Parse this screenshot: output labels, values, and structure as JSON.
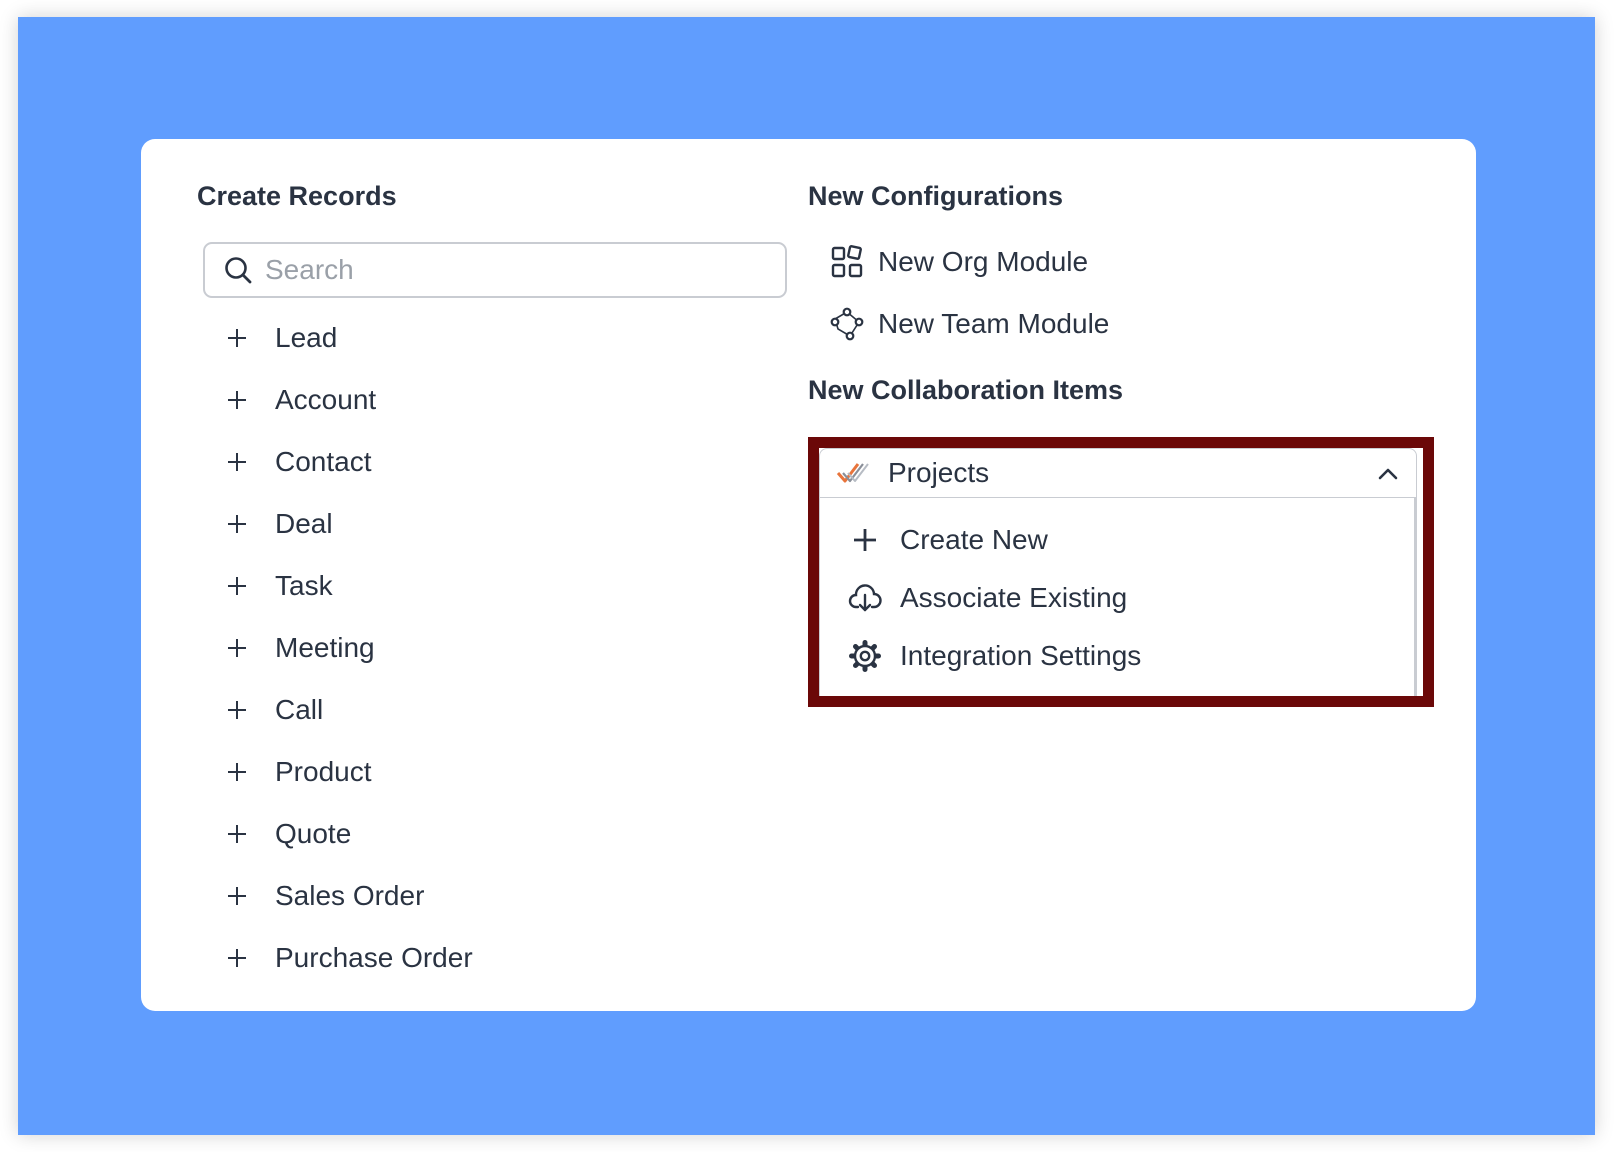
{
  "create_records": {
    "heading": "Create Records",
    "search": {
      "placeholder": "Search",
      "value": ""
    },
    "items": [
      {
        "label": "Lead"
      },
      {
        "label": "Account"
      },
      {
        "label": "Contact"
      },
      {
        "label": "Deal"
      },
      {
        "label": "Task"
      },
      {
        "label": "Meeting"
      },
      {
        "label": "Call"
      },
      {
        "label": "Product"
      },
      {
        "label": "Quote"
      },
      {
        "label": "Sales Order"
      },
      {
        "label": "Purchase Order"
      }
    ]
  },
  "new_configurations": {
    "heading": "New Configurations",
    "items": [
      {
        "label": "New Org Module",
        "icon": "grid-module-icon"
      },
      {
        "label": "New Team Module",
        "icon": "team-network-icon"
      }
    ]
  },
  "collaboration": {
    "heading": "New Collaboration Items",
    "dropdown": {
      "label": "Projects",
      "icon": "projects-check-icon",
      "expanded": true,
      "items": [
        {
          "label": "Create New",
          "icon": "plus-icon"
        },
        {
          "label": "Associate Existing",
          "icon": "cloud-download-icon"
        },
        {
          "label": "Integration Settings",
          "icon": "gear-icon"
        }
      ]
    },
    "highlight_color": "#6b0808"
  },
  "colors": {
    "backdrop": "#609dfe",
    "text": "#2a3342",
    "border": "#c9ccd2",
    "accent_orange": "#e8743b"
  }
}
